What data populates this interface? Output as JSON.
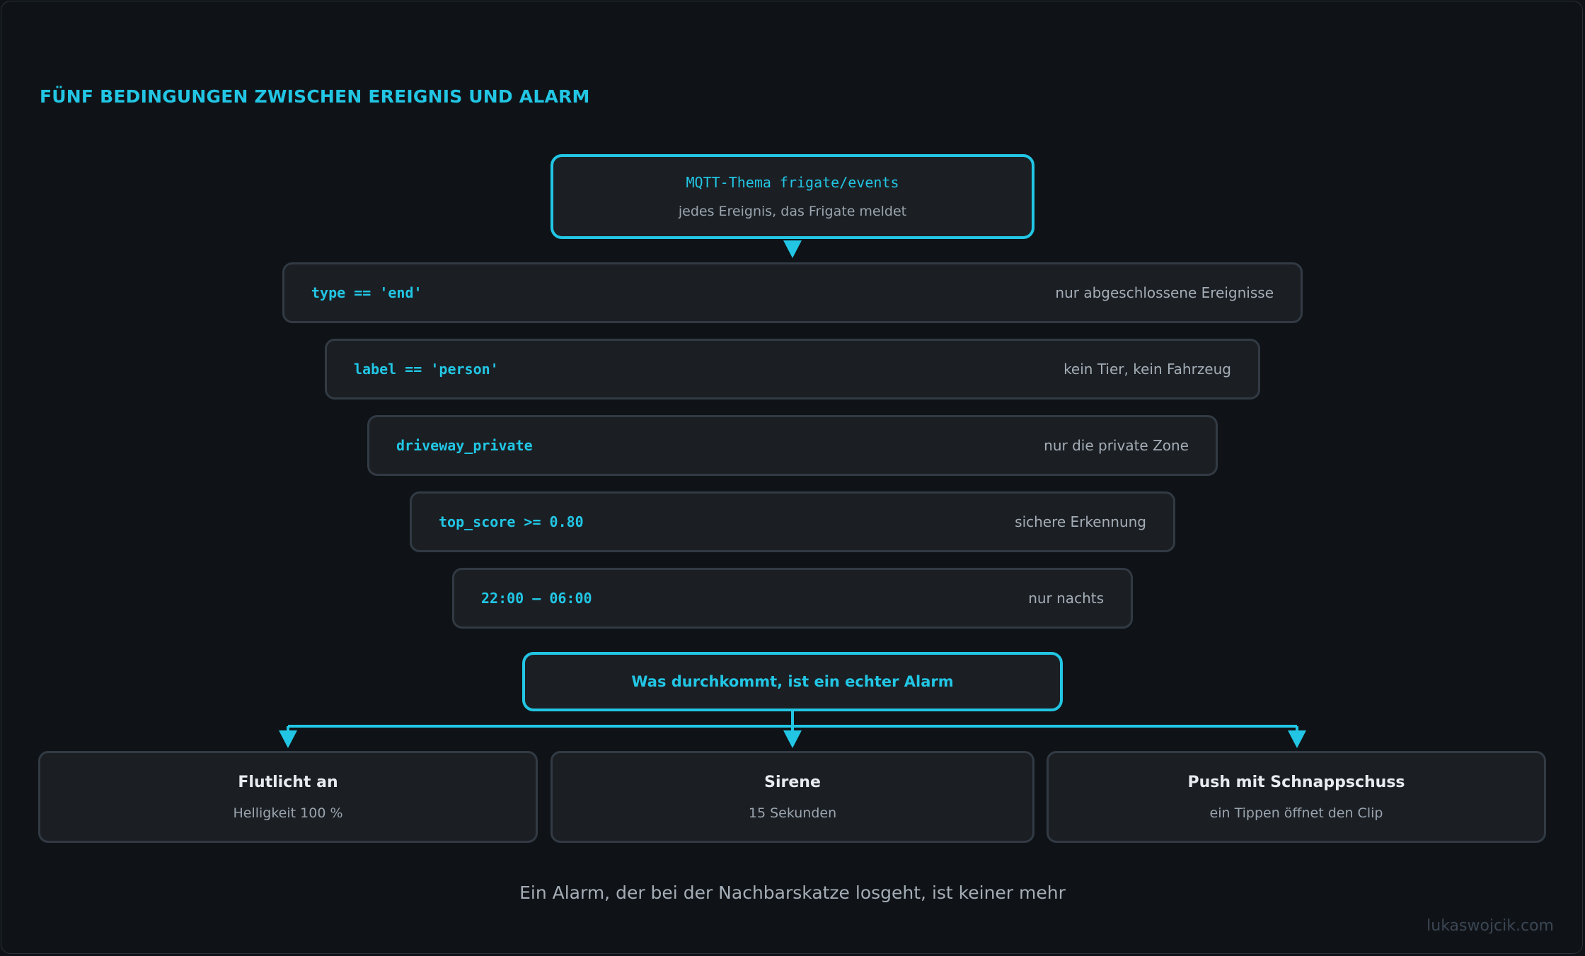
{
  "title": "FÜNF BEDINGUNGEN ZWISCHEN EREIGNIS UND ALARM",
  "source": {
    "topic": "MQTT-Thema frigate/events",
    "subtitle": "jedes Ereignis, das Frigate meldet"
  },
  "conditions": [
    {
      "code": "type == 'end'",
      "desc": "nur abgeschlossene Ereignisse"
    },
    {
      "code": "label == 'person'",
      "desc": "kein Tier, kein Fahrzeug"
    },
    {
      "code": "driveway_private",
      "desc": "nur die private Zone"
    },
    {
      "code": "top_score >= 0.80",
      "desc": "sichere Erkennung"
    },
    {
      "code": "22:00 – 06:00",
      "desc": "nur nachts"
    }
  ],
  "result": "Was durchkommt, ist ein echter Alarm",
  "outputs": [
    {
      "title": "Flutlicht an",
      "subtitle": "Helligkeit 100 %"
    },
    {
      "title": "Sirene",
      "subtitle": "15 Sekunden"
    },
    {
      "title": "Push mit Schnappschuss",
      "subtitle": "ein Tippen öffnet den Clip"
    }
  ],
  "footer": "Ein Alarm, der bei der Nachbarskatze losgeht, ist keiner mehr",
  "credit": "lukaswojcik.com",
  "colors": {
    "accent": "#22c6e4",
    "background": "#0f1317",
    "box": "#1b1f24"
  }
}
